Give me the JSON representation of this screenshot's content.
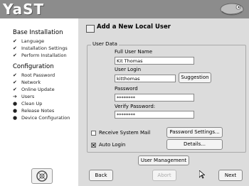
{
  "header": {
    "app_name": "YaST",
    "brand_logo": "suse-chameleon-logo"
  },
  "sidebar": {
    "base_title": "Base Installation",
    "base_steps": [
      {
        "label": "Language",
        "status": "done"
      },
      {
        "label": "Installation Settings",
        "status": "done"
      },
      {
        "label": "Perform Installation",
        "status": "done"
      }
    ],
    "config_title": "Configuration",
    "config_steps": [
      {
        "label": "Root Password",
        "status": "done"
      },
      {
        "label": "Network",
        "status": "done"
      },
      {
        "label": "Online Update",
        "status": "done"
      },
      {
        "label": "Users",
        "status": "current"
      },
      {
        "label": "Clean Up",
        "status": "pending"
      },
      {
        "label": "Release Notes",
        "status": "pending"
      },
      {
        "label": "Device Configuration",
        "status": "pending"
      }
    ],
    "marks": {
      "done": "✔",
      "current": "➔",
      "pending": "●"
    }
  },
  "dialog": {
    "title": "Add a New Local User",
    "frame_label": "User Data",
    "full_name_label": "Full User Name",
    "full_name_value": "Kit Thomas",
    "login_label": "User Login",
    "login_value": "kitthomas",
    "suggestion_button": "Suggestion",
    "password_label": "Password",
    "password_value": "********",
    "verify_label": "Verify Password:",
    "verify_value": "********",
    "receive_mail_label": "Receive System Mail",
    "receive_mail_checked": false,
    "password_settings_button": "Password Settings...",
    "auto_login_label": "Auto Login",
    "auto_login_checked": true,
    "details_button": "Details...",
    "user_management_button": "User Management"
  },
  "footer": {
    "back_button": "Back",
    "abort_button": "Abort",
    "next_button": "Next"
  }
}
